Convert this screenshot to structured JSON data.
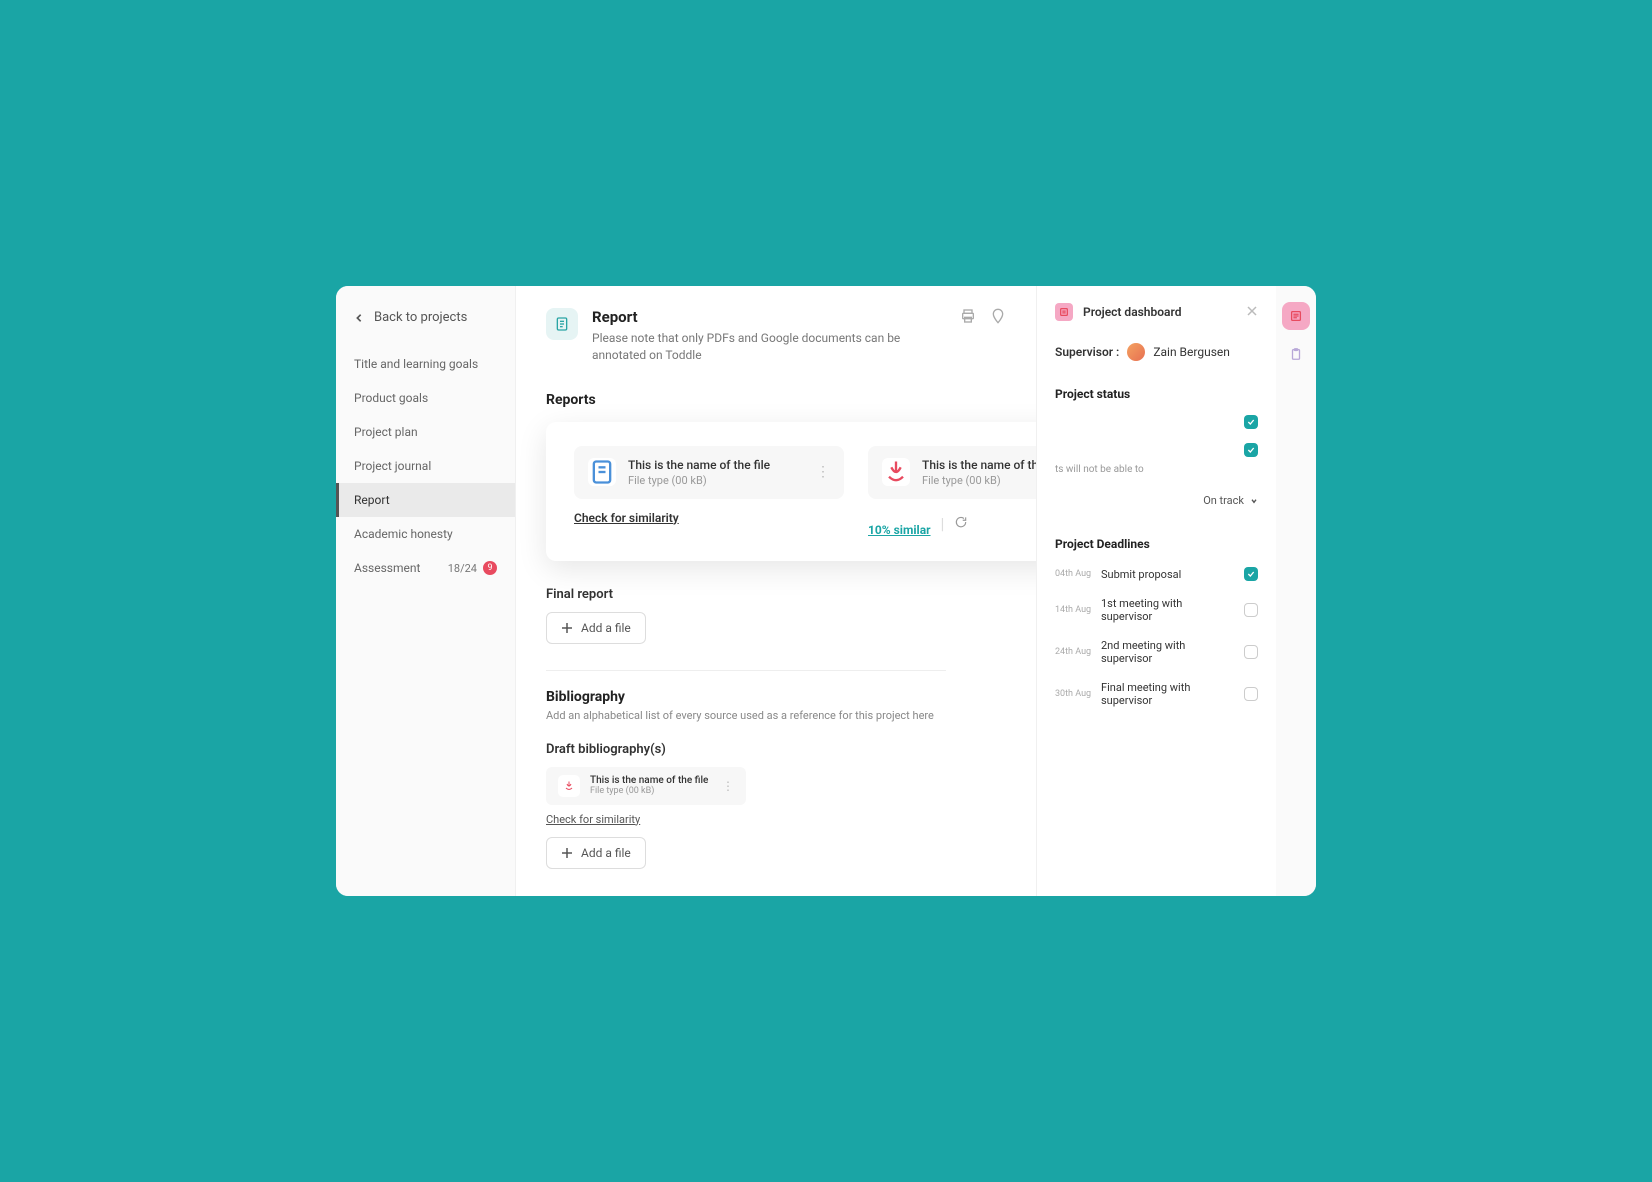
{
  "back_link": "Back to projects",
  "nav": [
    {
      "label": "Title and learning goals"
    },
    {
      "label": "Product goals"
    },
    {
      "label": "Project plan"
    },
    {
      "label": "Project journal"
    },
    {
      "label": "Report",
      "active": true
    },
    {
      "label": "Academic honesty"
    },
    {
      "label": "Assessment",
      "count": "18/24",
      "badge": "9"
    }
  ],
  "page": {
    "title": "Report",
    "subtitle": "Please note that only PDFs and Google documents can be annotated on Toddle"
  },
  "reports_heading": "Reports",
  "file1": {
    "name": "This is the name of the file",
    "meta": "File type (00 kB)",
    "sim_link": "Check for similarity"
  },
  "file2": {
    "name": "This is the name of the file",
    "meta": "File type (00 kB)",
    "sim_result": "10% similar"
  },
  "final_report_heading": "Final report",
  "add_file_label": "Add a file",
  "bibliography": {
    "title": "Bibliography",
    "desc": "Add an alphabetical list of every source used as a reference for this project here",
    "draft_heading": "Draft bibliography(s)",
    "file": {
      "name": "This is the name of the file",
      "meta": "File type (00 kB)"
    },
    "sim_link": "Check for similarity"
  },
  "dashboard": {
    "title": "Project dashboard",
    "supervisor_label": "Supervisor :",
    "supervisor_name": "Zain Bergusen",
    "status_title": "Project status",
    "status_note": "ts will not be able to",
    "track_label": "On track",
    "deadlines_title": "Project Deadlines",
    "deadlines": [
      {
        "date": "04th Aug",
        "label": "Submit proposal",
        "checked": true
      },
      {
        "date": "14th Aug",
        "label": "1st meeting with supervisor",
        "checked": false
      },
      {
        "date": "24th Aug",
        "label": "2nd meeting with supervisor",
        "checked": false
      },
      {
        "date": "30th Aug",
        "label": "Final meeting with supervisor",
        "checked": false
      }
    ]
  }
}
